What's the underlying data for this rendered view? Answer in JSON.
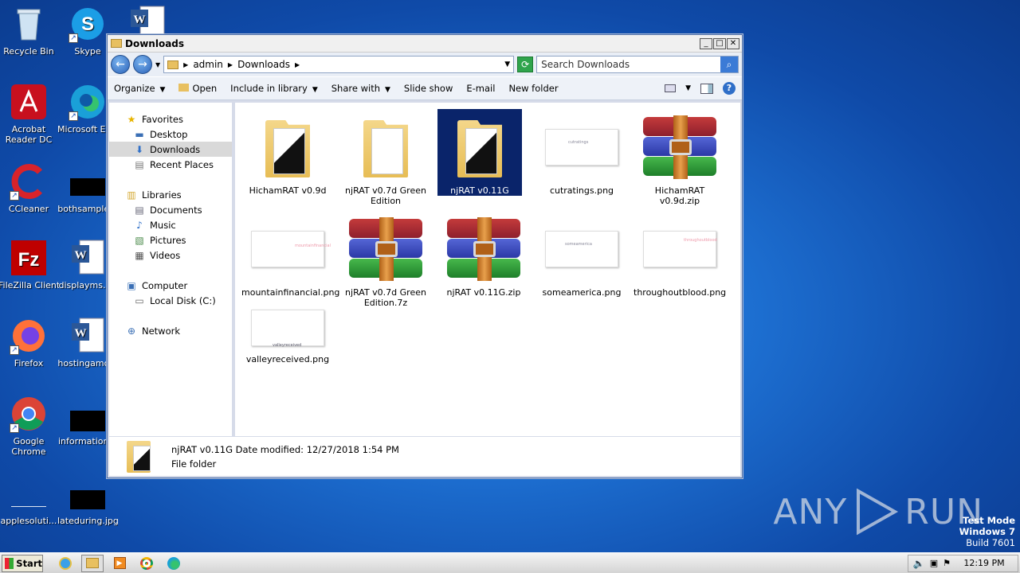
{
  "desktop": {
    "icons": [
      {
        "label": "Recycle Bin"
      },
      {
        "label": "Skype"
      },
      {
        "label": "Acrobat Reader DC"
      },
      {
        "label": "Microsoft Ed..."
      },
      {
        "label": "CCleaner"
      },
      {
        "label": "bothsample..."
      },
      {
        "label": "FileZilla Client"
      },
      {
        "label": "displayms.r..."
      },
      {
        "label": "Firefox"
      },
      {
        "label": "hostingamo..."
      },
      {
        "label": "Google Chrome"
      },
      {
        "label": "information..."
      },
      {
        "label": "applesoluti..."
      },
      {
        "label": "lateduring.jpg"
      }
    ]
  },
  "window": {
    "title": "Downloads",
    "breadcrumb": [
      "admin",
      "Downloads"
    ],
    "search_placeholder": "Search Downloads",
    "toolbar": {
      "organize": "Organize",
      "open": "Open",
      "include": "Include in library",
      "share": "Share with",
      "slideshow": "Slide show",
      "email": "E-mail",
      "newfolder": "New folder"
    },
    "nav": {
      "favorites": "Favorites",
      "desktop": "Desktop",
      "downloads": "Downloads",
      "recent": "Recent Places",
      "libraries": "Libraries",
      "documents": "Documents",
      "music": "Music",
      "pictures": "Pictures",
      "videos": "Videos",
      "computer": "Computer",
      "localdisk": "Local Disk (C:)",
      "network": "Network"
    },
    "files": [
      {
        "name": "HichamRAT v0.9d"
      },
      {
        "name": "njRAT v0.7d Green Edition"
      },
      {
        "name": "njRAT v0.11G"
      },
      {
        "name": "cutratings.png"
      },
      {
        "name": "HichamRAT v0.9d.zip"
      },
      {
        "name": "mountainfinancial.png"
      },
      {
        "name": "njRAT v0.7d Green Edition.7z"
      },
      {
        "name": "njRAT v0.11G.zip"
      },
      {
        "name": "someamerica.png"
      },
      {
        "name": "throughoutblood.png"
      },
      {
        "name": "valleyreceived.png"
      }
    ],
    "details": {
      "name": "njRAT v0.11G",
      "modified_label": "Date modified:",
      "modified": "12/27/2018 1:54 PM",
      "type": "File folder"
    }
  },
  "taskbar": {
    "start": "Start",
    "clock": "12:19 PM"
  },
  "watermark": {
    "left": "ANY",
    "right": "RUN"
  },
  "system": {
    "line1": "Test Mode",
    "line2": "Windows 7",
    "line3": "Build 7601"
  }
}
